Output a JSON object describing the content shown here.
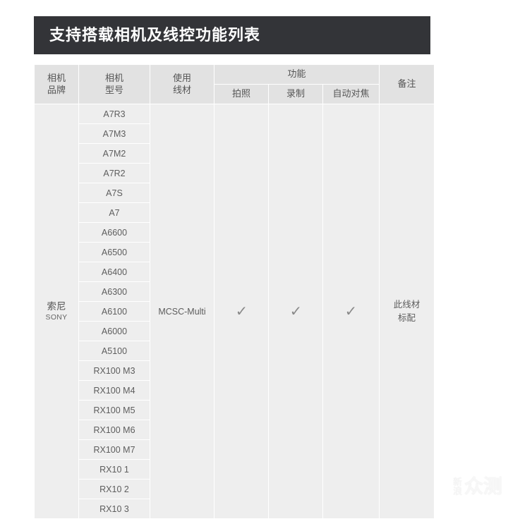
{
  "banner": {
    "title": "支持搭载相机及线控功能列表",
    "background_color": "#333438",
    "text_color": "#ffffff"
  },
  "table": {
    "headers": {
      "brand_line1": "相机",
      "brand_line2": "品牌",
      "model_line1": "相机",
      "model_line2": "型号",
      "cable_line1": "使用",
      "cable_line2": "线材",
      "function_group": "功能",
      "photo": "拍照",
      "record": "录制",
      "autofocus": "自动对焦",
      "note": "备注"
    },
    "brand": {
      "cn": "索尼",
      "en": "SONY"
    },
    "cable": "MCSC-Multi",
    "function_values": {
      "photo": "✓",
      "record": "✓",
      "autofocus": "✓"
    },
    "note_line1": "此线材",
    "note_line2": "标配",
    "models": [
      "A7R3",
      "A7M3",
      "A7M2",
      "A7R2",
      "A7S",
      "A7",
      "A6600",
      "A6500",
      "A6400",
      "A6300",
      "A6100",
      "A6000",
      "A5100",
      "RX100 M3",
      "RX100 M4",
      "RX100 M5",
      "RX100 M6",
      "RX100 M7",
      "RX10 1",
      "RX10 2",
      "RX10 3"
    ],
    "colors": {
      "cell_background": "#eeeeee",
      "header_background": "#e2e2e2",
      "grid_line": "#ffffff",
      "text": "#5c5c5c",
      "check_mark": "#8a8a8a"
    }
  },
  "watermark": {
    "small_line1": "新",
    "small_line2": "浪",
    "big": "众测"
  }
}
